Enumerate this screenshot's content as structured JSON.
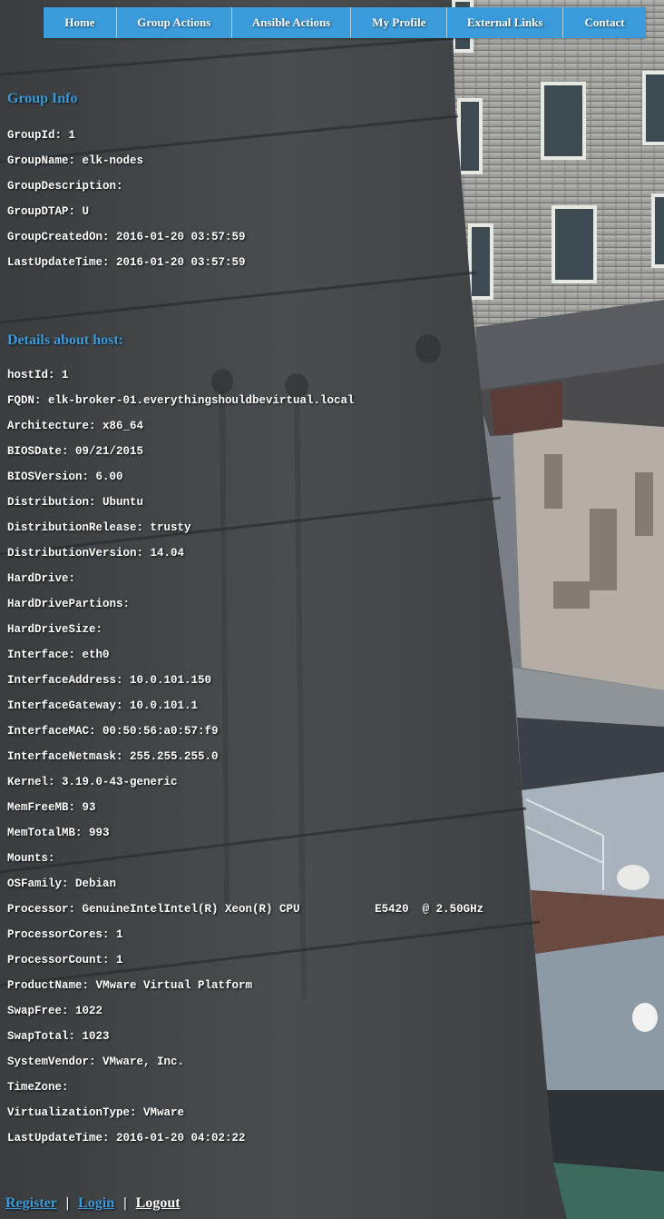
{
  "nav": {
    "items": [
      {
        "label": "Home"
      },
      {
        "label": "Group Actions"
      },
      {
        "label": "Ansible Actions"
      },
      {
        "label": "My Profile"
      },
      {
        "label": "External Links"
      },
      {
        "label": "Contact"
      }
    ]
  },
  "group_info": {
    "title": "Group Info",
    "rows": [
      "GroupId: 1",
      "GroupName: elk-nodes",
      "GroupDescription:",
      "GroupDTAP: U",
      "GroupCreatedOn: 2016-01-20 03:57:59",
      "LastUpdateTime: 2016-01-20 03:57:59"
    ]
  },
  "host_details": {
    "title": "Details about host:",
    "rows": [
      "hostId: 1",
      "FQDN: elk-broker-01.everythingshouldbevirtual.local",
      "Architecture: x86_64",
      "BIOSDate: 09/21/2015",
      "BIOSVersion: 6.00",
      "Distribution: Ubuntu",
      "DistributionRelease: trusty",
      "DistributionVersion: 14.04",
      "HardDrive:",
      "HardDrivePartions:",
      "HardDriveSize:",
      "Interface: eth0",
      "InterfaceAddress: 10.0.101.150",
      "InterfaceGateway: 10.0.101.1",
      "InterfaceMAC: 00:50:56:a0:57:f9",
      "InterfaceNetmask: 255.255.255.0",
      "Kernel: 3.19.0-43-generic",
      "MemFreeMB: 93",
      "MemTotalMB: 993",
      "Mounts:",
      "OSFamily: Debian",
      "Processor: GenuineIntelIntel(R) Xeon(R) CPU           E5420  @ 2.50GHz",
      "ProcessorCores: 1",
      "ProcessorCount: 1",
      "ProductName: VMware Virtual Platform",
      "SwapFree: 1022",
      "SwapTotal: 1023",
      "SystemVendor: VMware, Inc.",
      "TimeZone:",
      "VirtualizationType: VMware",
      "LastUpdateTime: 2016-01-20 04:02:22"
    ]
  },
  "footer": {
    "register": "Register",
    "login": "Login",
    "logout": "Logout",
    "separator": "|"
  },
  "colors": {
    "accent": "#3b9ad9",
    "text": "#ffffff"
  }
}
